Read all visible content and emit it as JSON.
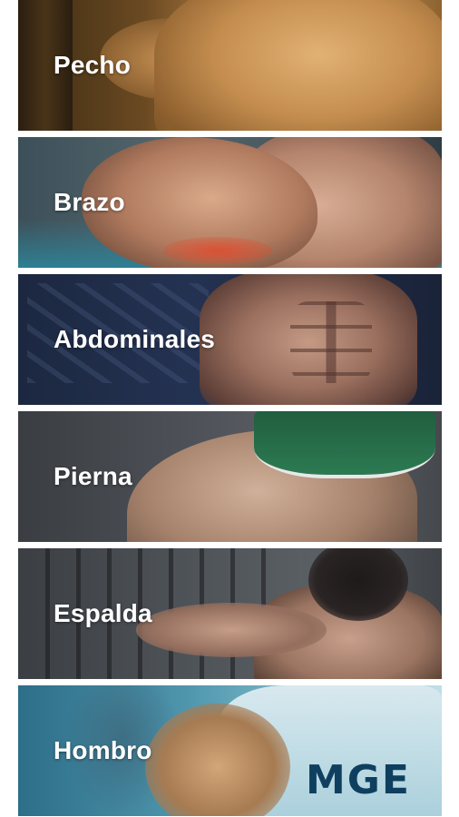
{
  "categories": [
    {
      "label": "Pecho"
    },
    {
      "label": "Brazo"
    },
    {
      "label": "Abdominales"
    },
    {
      "label": "Pierna"
    },
    {
      "label": "Espalda"
    },
    {
      "label": "Hombro"
    }
  ],
  "hombro_card": {
    "logo_text": "MGE"
  }
}
